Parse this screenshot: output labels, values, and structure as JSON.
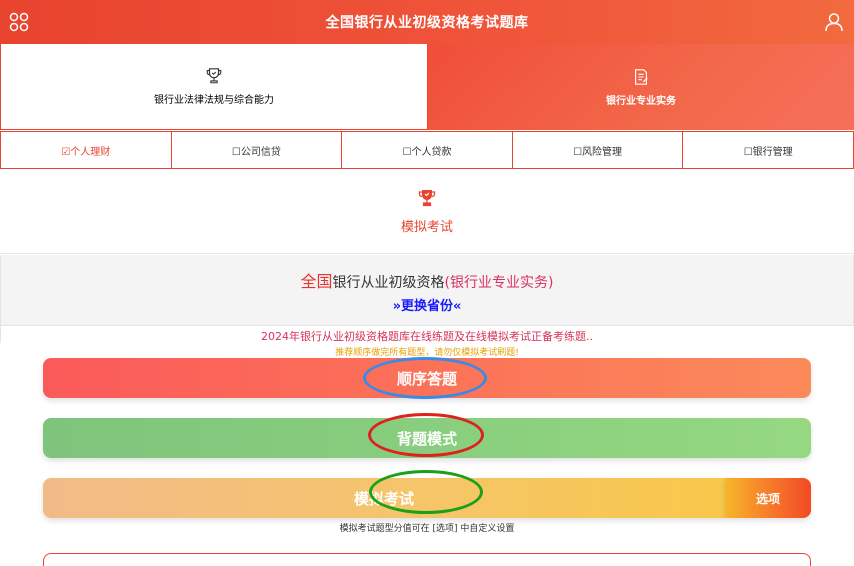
{
  "header": {
    "title": "全国银行从业初级资格考试题库"
  },
  "categories": [
    {
      "label": "银行业法律法规与综合能力",
      "icon": "trophy-icon",
      "active": false
    },
    {
      "label": "银行业专业实务",
      "icon": "document-icon",
      "active": true
    }
  ],
  "subtabs": [
    {
      "label": "☑个人理财"
    },
    {
      "label": "☐公司信贷"
    },
    {
      "label": "☐个人贷款"
    },
    {
      "label": "☐风险管理"
    },
    {
      "label": "☐银行管理"
    }
  ],
  "mock": {
    "label": "模拟考试",
    "icon": "trophy-icon"
  },
  "info": {
    "region": "全国",
    "exam": "银行从业初级资格",
    "subject": "(银行业专业实务)",
    "change_region": "»更换省份«"
  },
  "notice": {
    "line1": "2024年银行从业初级资格题库在线练题及在线模拟考试正备考练题..",
    "line2": "推荐顺序做完所有题型，请勿仅模拟考试刷题!"
  },
  "buttons": {
    "sequential": "顺序答题",
    "memorize": "背题模式",
    "mock_exam": "模拟考试",
    "options": "选项"
  },
  "hint": "模拟考试题型分值可在 [选项] 中自定义设置",
  "colors": {
    "accent": "#e8432e",
    "sequential": "#fb6a5a",
    "memorize": "#8bd07e",
    "mock_exam": "#f5c56a",
    "ring_blue": "#3a8ae6",
    "ring_red": "#e02020",
    "ring_green": "#1aa01a"
  }
}
